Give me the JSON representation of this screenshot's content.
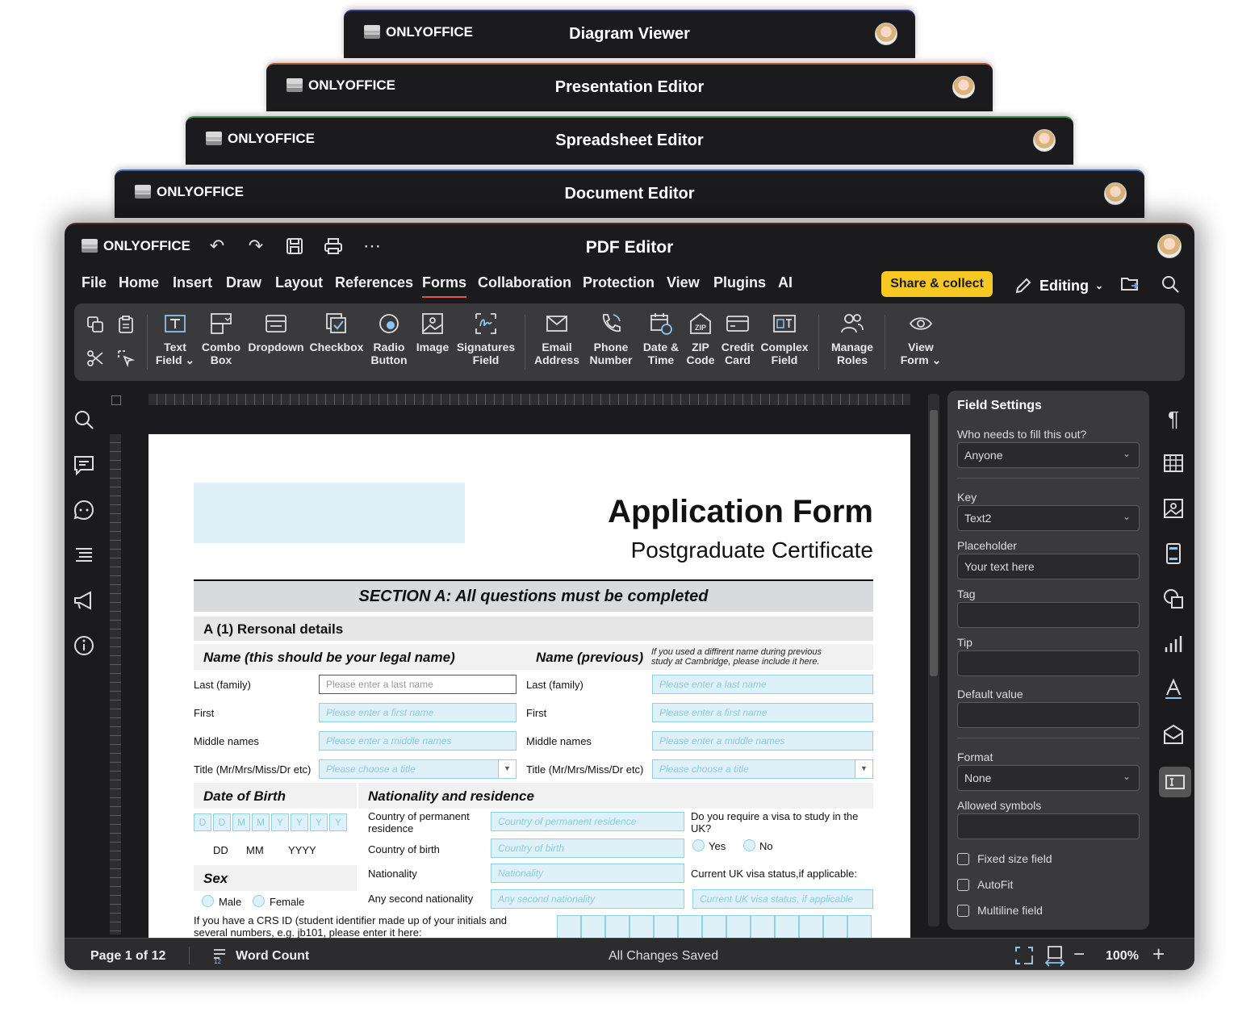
{
  "brand": "ONLYOFFICE",
  "stack_windows": [
    {
      "title": "Diagram Viewer",
      "accent": "#3a3a9a"
    },
    {
      "title": "Presentation Editor",
      "accent": "#b5553a"
    },
    {
      "title": "Spreadsheet Editor",
      "accent": "#3a8a4a"
    },
    {
      "title": "Document Editor",
      "accent": "#3a6ab5"
    }
  ],
  "main": {
    "title": "PDF Editor",
    "menu": [
      "File",
      "Home",
      "Insert",
      "Draw",
      "Layout",
      "References",
      "Forms",
      "Collaboration",
      "Protection",
      "View",
      "Plugins",
      "AI"
    ],
    "active_menu": "Forms",
    "share_label": "Share & collect",
    "editing_label": "Editing",
    "ribbon": {
      "text_field": "Text Field",
      "combo_box": "Combo Box",
      "dropdown": "Dropdown",
      "checkbox": "Checkbox",
      "radio_button": "Radio Button",
      "image": "Image",
      "signatures_field": "Signatures Field",
      "email_address": "Email Address",
      "phone_number": "Phone Number",
      "date_time": "Date & Time",
      "zip_code": "ZIP Code",
      "credit_card": "Credit Card",
      "complex_field": "Complex Field",
      "manage_roles": "Manage Roles",
      "view_form": "View Form"
    }
  },
  "document": {
    "title": "Application Form",
    "subtitle": "Postgraduate Certificate",
    "section_a": "SECTION A: All questions must be completed",
    "subsection": "A (1) Rersonal details",
    "name_header": "Name (this should be your legal name)",
    "name_prev_header": "Name (previous)",
    "prev_note": "If you used a diffirent name during previous study at Cambridge, please include it here.",
    "labels": {
      "last": "Last (family)",
      "first": "First",
      "middle": "Middle names",
      "title": "Title (Mr/Mrs/Miss/Dr etc)"
    },
    "placeholders": {
      "last": "Please enter a last name",
      "first": "Please enter a first name",
      "middle": "Please enter a middle names",
      "title": "Please choose a title"
    },
    "dob_header": "Date of Birth",
    "dob_cells": [
      "D",
      "D",
      "M",
      "M",
      "Y",
      "Y",
      "Y",
      "Y"
    ],
    "dob_labels": [
      "DD",
      "MM",
      "YYYY"
    ],
    "nationality_header": "Nationality and residence",
    "country_perm_label": "Country of permanent residence",
    "country_perm_ph": "Country of permanent residence",
    "country_birth_label": "Country of birth",
    "country_birth_ph": "Country of birth",
    "nationality_label": "Nationality",
    "nationality_ph": "Nationality",
    "second_nat_label": "Any second nationality",
    "second_nat_ph": "Any second nationality",
    "visa_question": "Do you require a visa to study in the UK?",
    "yes": "Yes",
    "no": "No",
    "visa_status_label": "Current UK visa status,if applicable:",
    "visa_status_ph": "Current UK visa status, if applicable",
    "sex_header": "Sex",
    "male": "Male",
    "female": "Female",
    "crs_note": "If you have a CRS ID (student identifier made up of your initials and several numbers, e.g. jb101, please enter it here:"
  },
  "field_settings": {
    "title": "Field Settings",
    "who_label": "Who needs to fill this out?",
    "who_value": "Anyone",
    "key_label": "Key",
    "key_value": "Text2",
    "placeholder_label": "Placeholder",
    "placeholder_value": "Your text here",
    "tag_label": "Tag",
    "tip_label": "Tip",
    "default_label": "Default value",
    "format_label": "Format",
    "format_value": "None",
    "allowed_label": "Allowed symbols",
    "fixed_size": "Fixed size field",
    "autofit": "AutoFit",
    "multiline": "Multiline field"
  },
  "status": {
    "page": "Page 1 of 12",
    "word_count": "Word Count",
    "saved": "All Changes Saved",
    "zoom": "100%"
  }
}
